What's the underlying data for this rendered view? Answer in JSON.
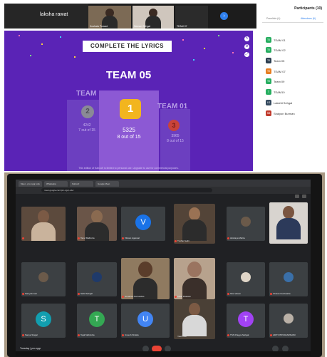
{
  "top_call": {
    "self_name": "laksha rawat",
    "strip_tiles": [
      {
        "name": "Kushata Prasad"
      },
      {
        "name": "Naman Sehgal"
      },
      {
        "name": "TEAM 07"
      }
    ]
  },
  "quiz": {
    "title": "COMPLETE THE LYRICS",
    "team": "TEAM 05",
    "left_label": "TEAM",
    "right_label": "TEAM 01",
    "first": {
      "rank": "1",
      "score": "5325",
      "detail": "8 out of 15"
    },
    "second": {
      "rank": "2",
      "score": "4242",
      "detail": "7 out of 15"
    },
    "third": {
      "rank": "3",
      "score": "3965",
      "detail": "8 out of 15"
    },
    "footer": "This edition of Kahoot! is limited to personal use. Upgrade to use for commercial purposes.",
    "colors": {
      "background": "#5a23b6",
      "gold": "#f2b51e",
      "silver": "#8a8a96",
      "bronze": "#c8433a"
    }
  },
  "participants": {
    "title": "Participants (10)",
    "tab_panelists": "Panelists (4)",
    "tab_attendees": "Attendees (6)",
    "items": [
      {
        "initials": "T0",
        "name": "TEAM 01",
        "color": "#27ae60"
      },
      {
        "initials": "T0",
        "name": "TEAM 02",
        "color": "#27ae60"
      },
      {
        "initials": "T0",
        "name": "Team 05",
        "color": "#2c3e50"
      },
      {
        "initials": "T0",
        "name": "TEAM 07",
        "color": "#e67e22"
      },
      {
        "initials": "T0",
        "name": "Team 09",
        "color": "#27ae60"
      },
      {
        "initials": "T",
        "name": "TEAM10",
        "color": "#27ae60"
      },
      {
        "initials": "LS",
        "name": "Lakshit Sehgal",
        "color": "#34495e"
      },
      {
        "initials": "SB",
        "name": "Shaiyon Burman",
        "color": "#c0392b"
      }
    ]
  },
  "meet": {
    "tabs": [
      "Meet - prx-ngqr-xdw",
      "WhatsApp",
      "Kahoot!",
      "Google Meet"
    ],
    "url": "meet.google.com/prx-ngqr-xdw",
    "meeting_code": "Tuesday | prx-ngqr",
    "tiles": [
      {
        "name": "",
        "type": "video"
      },
      {
        "name": "Tanvi Malhotra",
        "type": "video"
      },
      {
        "name": "Vikram Agarwal",
        "type": "letter",
        "letter": "V",
        "color": "#1a73e8"
      },
      {
        "name": "Tushar Sethi",
        "type": "video"
      },
      {
        "name": "Akshaya Mehta",
        "type": "mini"
      },
      {
        "name": "",
        "type": "video"
      },
      {
        "name": "Samyak Jain",
        "type": "mini"
      },
      {
        "name": "Sahil Sehgal",
        "type": "mini"
      },
      {
        "name": "Jonathan Fernandes",
        "type": "video"
      },
      {
        "name": "Mitali Dhawan",
        "type": "video"
      },
      {
        "name": "Tara Vasan",
        "type": "mini"
      },
      {
        "name": "Chetan Kushwaha",
        "type": "mini"
      },
      {
        "name": "Sanya Singal",
        "type": "letter",
        "letter": "S",
        "color": "#129eaf"
      },
      {
        "name": "Tejal Mahindra",
        "type": "letter",
        "letter": "T",
        "color": "#34a853"
      },
      {
        "name": "Umesh Shukla",
        "type": "letter",
        "letter": "U",
        "color": "#4285f4"
      },
      {
        "name": "Yash Dhir",
        "type": "video"
      },
      {
        "name": "TSS Pragya Sehgal",
        "type": "letter",
        "letter": "T",
        "color": "#a142f4"
      },
      {
        "name": "ADITI PRIYADARSHINI",
        "type": "mini"
      }
    ]
  }
}
